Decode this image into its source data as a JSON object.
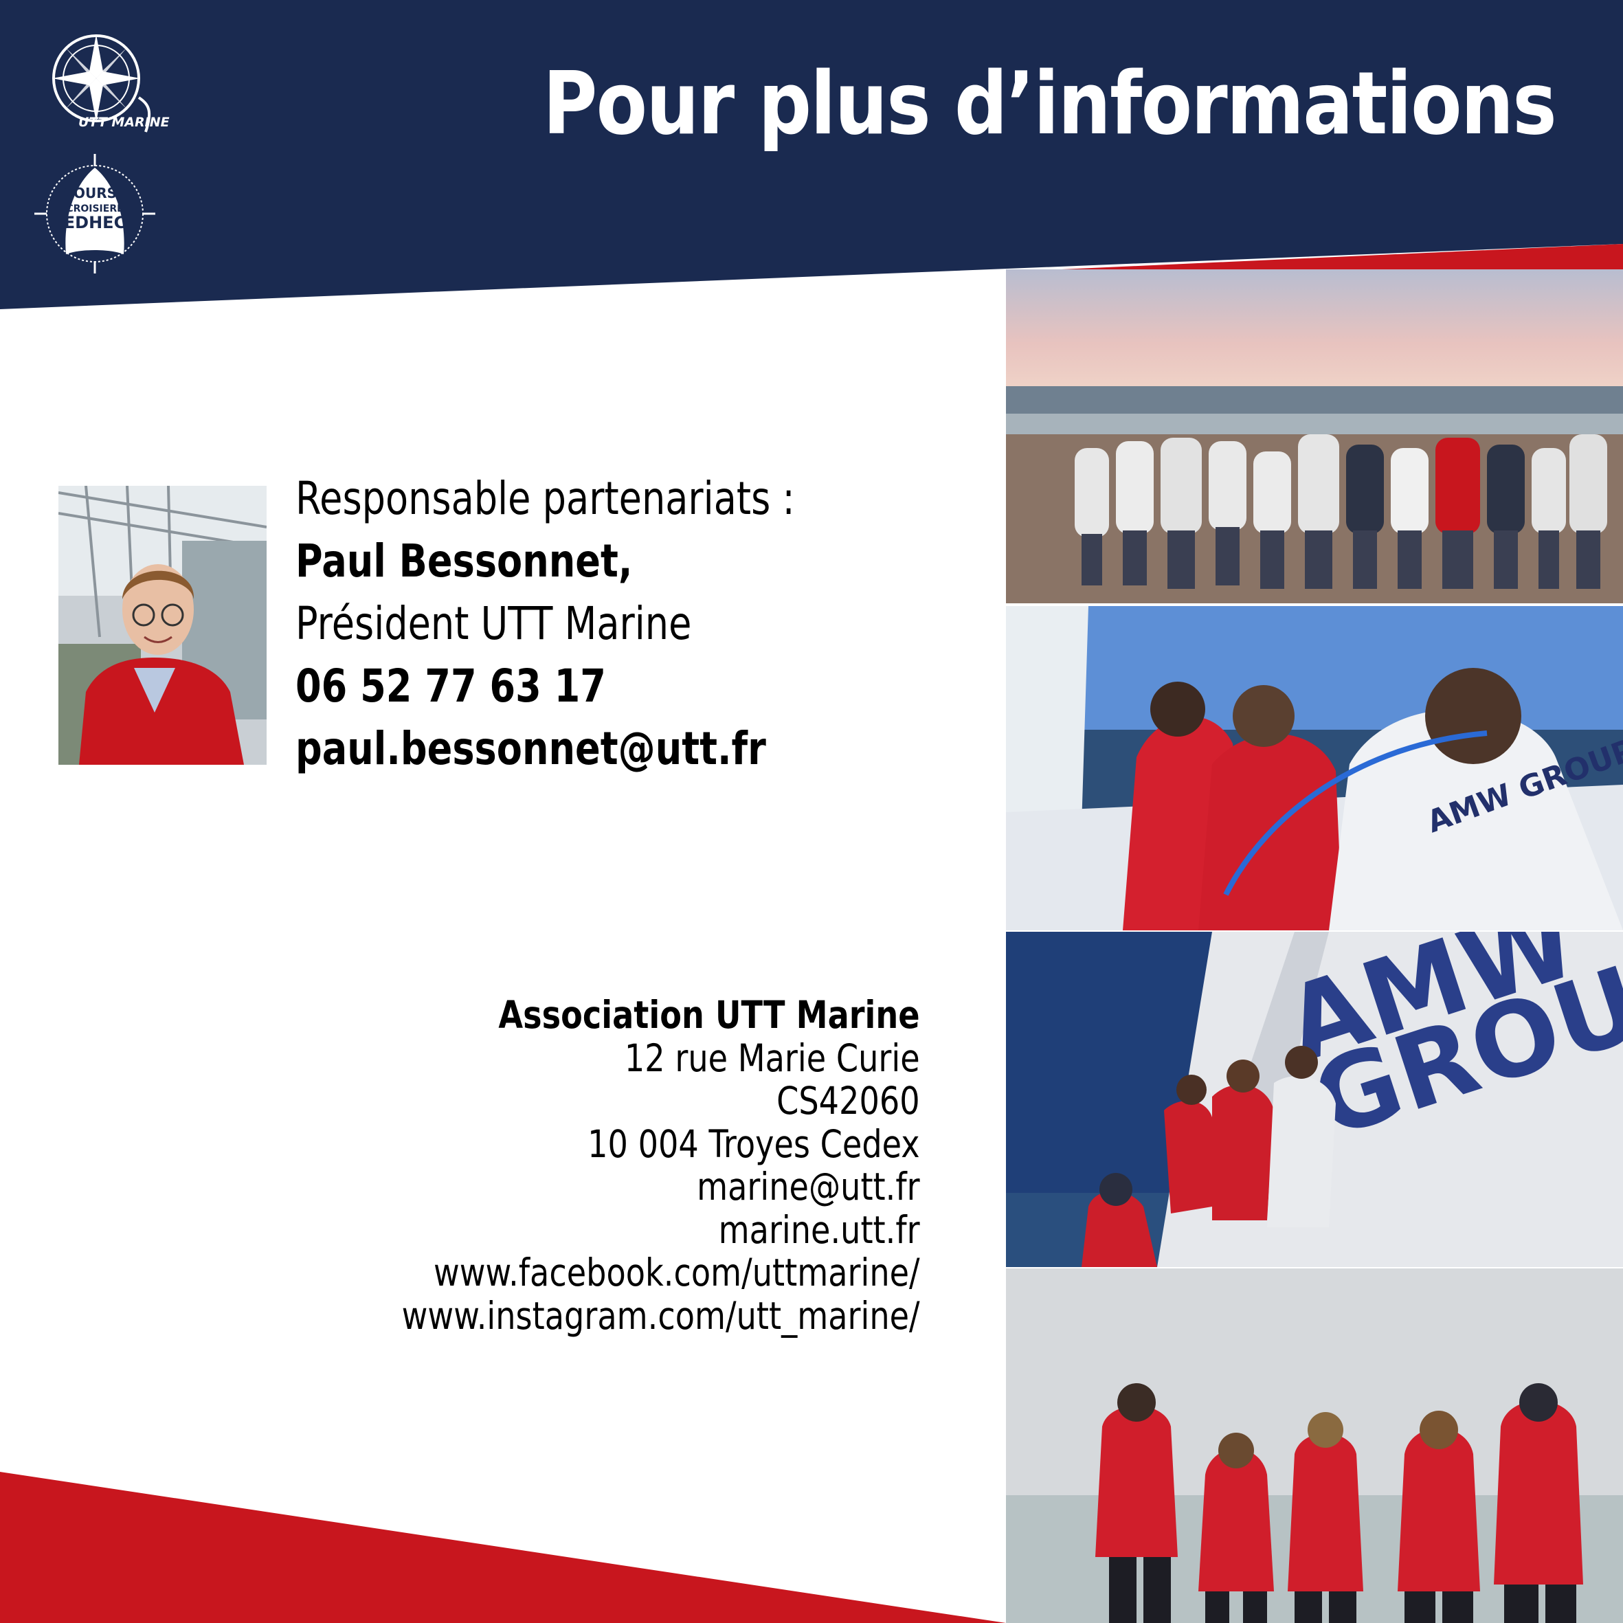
{
  "header": {
    "title": "Pour plus d’informations"
  },
  "logos": [
    {
      "name": "utt-marine-logo",
      "text": "UTT MARINE"
    },
    {
      "name": "course-croisiere-edhec-logo",
      "text": [
        "COURSE",
        "CROISIERE",
        "EDHEC"
      ]
    }
  ],
  "contact": {
    "role": "Responsable partenariats :",
    "name": "Paul Bessonnet,",
    "position": "Président UTT Marine",
    "phone": "06 52 77 63 17",
    "email": "paul.bessonnet@utt.fr"
  },
  "address": {
    "org": "Association UTT Marine",
    "street": "12 rue Marie Curie",
    "cs": "CS42060",
    "city": "10 004 Troyes Cedex",
    "email": "marine@utt.fr",
    "website": "marine.utt.fr",
    "facebook": "www.facebook.com/uttmarine/",
    "instagram": "www.instagram.com/utt_marine/"
  },
  "colors": {
    "navy": "#1a2a50",
    "red": "#c8161e",
    "white": "#ffffff"
  }
}
